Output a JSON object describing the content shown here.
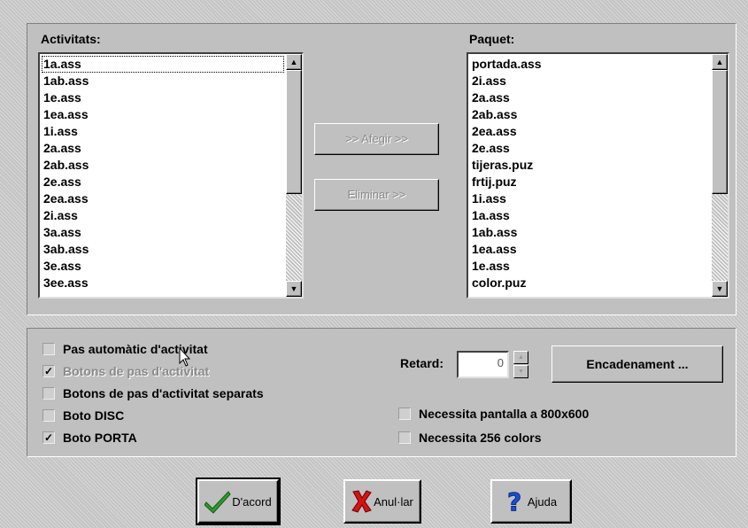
{
  "activitats": {
    "label": "Activitats:",
    "items": [
      "1a.ass",
      "1ab.ass",
      "1e.ass",
      "1ea.ass",
      "1i.ass",
      "2a.ass",
      "2ab.ass",
      "2e.ass",
      "2ea.ass",
      "2i.ass",
      "3a.ass",
      "3ab.ass",
      "3e.ass",
      "3ee.ass"
    ]
  },
  "paquet": {
    "label": "Paquet:",
    "items": [
      "portada.ass",
      "2i.ass",
      "2a.ass",
      "2ab.ass",
      "2ea.ass",
      "2e.ass",
      "tijeras.puz",
      "frtij.puz",
      "1i.ass",
      "1a.ass",
      "1ab.ass",
      "1ea.ass",
      "1e.ass",
      "color.puz"
    ]
  },
  "transfer": {
    "add_label": ">> Afegir >>",
    "remove_label": "Eliminar >>"
  },
  "options": {
    "checkboxes": [
      {
        "label": "Pas automàtic d'activitat",
        "checked": false,
        "disabled": false
      },
      {
        "label": "Botons de pas d'activitat",
        "checked": true,
        "disabled": true
      },
      {
        "label": "Botons de pas d'activitat separats",
        "checked": false,
        "disabled": false
      },
      {
        "label": "Boto DISC",
        "checked": false,
        "disabled": false
      },
      {
        "label": "Boto PORTA",
        "checked": true,
        "disabled": false
      }
    ],
    "retard_label": "Retard:",
    "retard_value": "0",
    "chain_button": "Encadenament ...",
    "screen_800": {
      "label": "Necessita pantalla a 800x600",
      "checked": false
    },
    "colors_256": {
      "label": "Necessita 256 colors",
      "checked": false
    }
  },
  "footer": {
    "ok_label": "D'acord",
    "cancel_label": "Anul·lar",
    "help_label": "Ajuda"
  },
  "colors": {
    "check_green": "#2e9a2e",
    "cancel_red": "#d21414",
    "help_blue": "#1a4fd1"
  }
}
